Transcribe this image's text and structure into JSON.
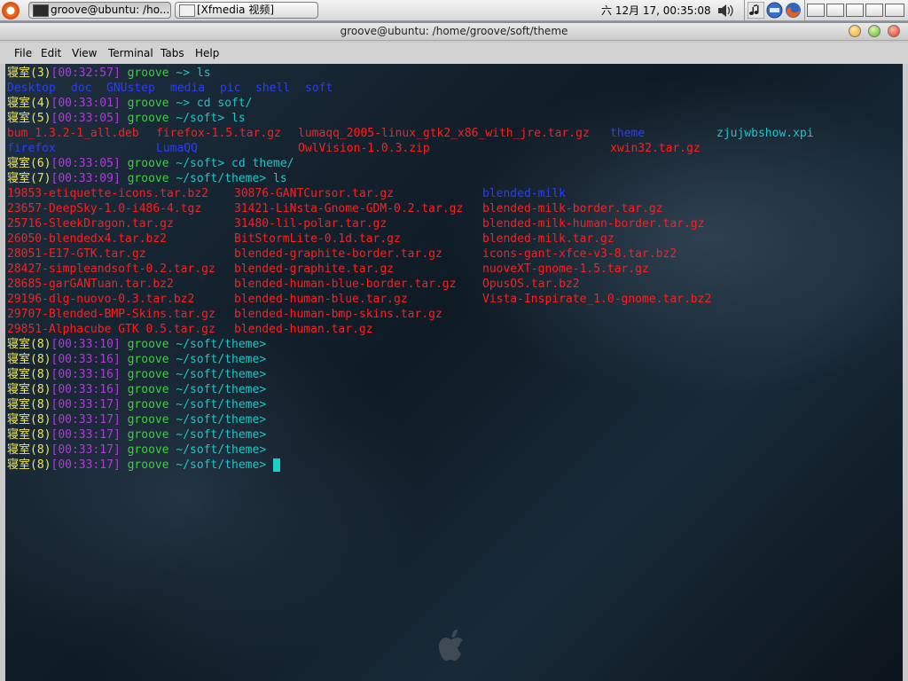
{
  "panel": {
    "tasks": [
      {
        "label": "groove@ubuntu: /ho...",
        "icon": "terminal-icon"
      },
      {
        "label": "[Xfmedia 视频]",
        "icon": "media-window-icon"
      }
    ],
    "clock": "六 12月 17, 00:35:08",
    "tray_icons": [
      "volume-icon",
      "music-note-icon",
      "network-icon",
      "firefox-icon"
    ],
    "window_list_buttons": [
      "window-button-1",
      "window-button-2",
      "window-button-3",
      "window-button-4"
    ]
  },
  "window": {
    "title": "groove@ubuntu: /home/groove/soft/theme",
    "menu": [
      "File",
      "Edit",
      "View",
      "Terminal",
      "Tabs",
      "Help"
    ]
  },
  "colors": {
    "host": "#f2e84e",
    "time": "#b03cd8",
    "user": "#3ad23a",
    "path": "#19c8c8",
    "directory": "#2a3cff",
    "archive": "#ff1e1e",
    "cursor": "#19d0c8"
  },
  "terminal": {
    "prompt_host": "寝室",
    "prompt_user": "groove",
    "prompts": [
      {
        "num": "(3)",
        "time": "[00:32:57]",
        "path": "~>",
        "cmd": " ls"
      },
      {
        "num": "(4)",
        "time": "[00:33:01]",
        "path": "~>",
        "cmd": " cd soft/"
      },
      {
        "num": "(5)",
        "time": "[00:33:05]",
        "path": "~/soft>",
        "cmd": " ls"
      },
      {
        "num": "(6)",
        "time": "[00:33:05]",
        "path": "~/soft>",
        "cmd": " cd theme/"
      },
      {
        "num": "(7)",
        "time": "[00:33:09]",
        "path": "~/soft/theme>",
        "cmd": " ls"
      },
      {
        "num": "(8)",
        "time": "[00:33:10]",
        "path": "~/soft/theme>",
        "cmd": ""
      },
      {
        "num": "(8)",
        "time": "[00:33:16]",
        "path": "~/soft/theme>",
        "cmd": ""
      },
      {
        "num": "(8)",
        "time": "[00:33:16]",
        "path": "~/soft/theme>",
        "cmd": ""
      },
      {
        "num": "(8)",
        "time": "[00:33:16]",
        "path": "~/soft/theme>",
        "cmd": ""
      },
      {
        "num": "(8)",
        "time": "[00:33:17]",
        "path": "~/soft/theme>",
        "cmd": ""
      },
      {
        "num": "(8)",
        "time": "[00:33:17]",
        "path": "~/soft/theme>",
        "cmd": ""
      },
      {
        "num": "(8)",
        "time": "[00:33:17]",
        "path": "~/soft/theme>",
        "cmd": ""
      },
      {
        "num": "(8)",
        "time": "[00:33:17]",
        "path": "~/soft/theme>",
        "cmd": ""
      },
      {
        "num": "(8)",
        "time": "[00:33:17]",
        "path": "~/soft/theme>",
        "cmd": ""
      }
    ],
    "home_listing": [
      "Desktop",
      "doc",
      "GNUstep",
      "media",
      "pic",
      "shell",
      "soft"
    ],
    "soft_listing": [
      {
        "text": "bum_1.3.2-1_all.deb",
        "kind": "archive"
      },
      {
        "text": "firefox-1.5.tar.gz",
        "kind": "archive"
      },
      {
        "text": "lumaqq_2005-linux_gtk2_x86_with_jre.tar.gz",
        "kind": "archive"
      },
      {
        "text": "theme",
        "kind": "directory"
      },
      {
        "text": "zjujwbshow.xpi",
        "kind": "file"
      },
      {
        "text": "firefox",
        "kind": "directory"
      },
      {
        "text": "LumaQQ",
        "kind": "directory"
      },
      {
        "text": "OwlVision-1.0.3.zip",
        "kind": "archive"
      },
      {
        "text": "xwin32.tar.gz",
        "kind": "archive"
      }
    ],
    "theme_col1": [
      "19853-etiquette-icons.tar.bz2",
      "23657-DeepSky-1.0-i486-4.tgz",
      "25716-SleekDragon.tar.gz",
      "26050-blendedx4.tar.bz2",
      "28051-E17-GTK.tar.gz",
      "28427-simpleandsoft-0.2.tar.gz",
      "28685-garGANTuan.tar.bz2",
      "29196-dlg-nuovo-0.3.tar.bz2",
      "29707-Blended-BMP-Skins.tar.gz",
      "29851-Alphacube GTK 0.5.tar.gz"
    ],
    "theme_col2": [
      "30876-GANTCursor.tar.gz",
      "31421-LiNsta-Gnome-GDM-0.2.tar.gz",
      "31480-lil-polar.tar.gz",
      "BitStormLite-0.1d.tar.gz",
      "blended-graphite-border.tar.gz",
      "blended-graphite.tar.gz",
      "blended-human-blue-border.tar.gz",
      "blended-human-blue.tar.gz",
      "blended-human-bmp-skins.tar.gz",
      "blended-human.tar.gz"
    ],
    "theme_col3": [
      {
        "text": "blended-milk",
        "kind": "directory"
      },
      {
        "text": "blended-milk-border.tar.gz",
        "kind": "archive"
      },
      {
        "text": "blended-milk-human-border.tar.gz",
        "kind": "archive"
      },
      {
        "text": "blended-milk.tar.gz",
        "kind": "archive"
      },
      {
        "text": "icons-gant-xfce-v3-8.tar.bz2",
        "kind": "archive"
      },
      {
        "text": "nuoveXT-gnome-1.5.tar.gz",
        "kind": "archive"
      },
      {
        "text": "OpusOS.tar.bz2",
        "kind": "archive"
      },
      {
        "text": "Vista-Inspirate_1.0-gnome.tar.bz2",
        "kind": "archive"
      }
    ]
  }
}
